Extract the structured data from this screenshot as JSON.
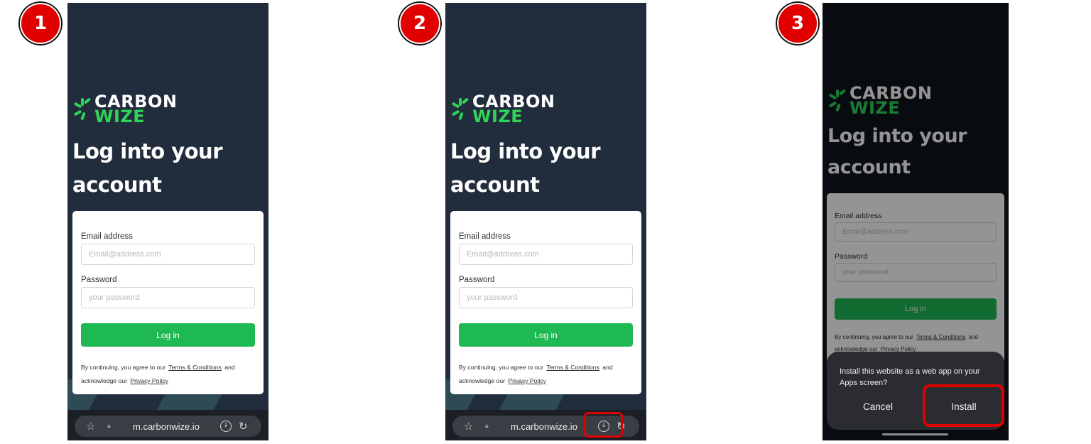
{
  "steps": [
    {
      "badge": "1",
      "logo": {
        "line1": "CARBON",
        "line2": "WIZE"
      },
      "headline": "Log into your account",
      "form": {
        "email_label": "Email address",
        "email_placeholder": "Email@address.com",
        "password_label": "Password",
        "password_placeholder": "your password",
        "login_label": "Log in",
        "legal_prefix": "By continuing, you agree to our",
        "terms_link": "Terms & Conditions",
        "legal_mid": "and acknowledge our",
        "privacy_link": "Privacy Policy"
      },
      "browser": {
        "url": "m.carbonwize.io"
      }
    },
    {
      "badge": "2",
      "logo": {
        "line1": "CARBON",
        "line2": "WIZE"
      },
      "headline": "Log into your account",
      "form": {
        "email_label": "Email address",
        "email_placeholder": "Email@address.com",
        "password_label": "Password",
        "password_placeholder": "your password",
        "login_label": "Log in",
        "legal_prefix": "By continuing, you agree to our",
        "terms_link": "Terms & Conditions",
        "legal_mid": "and acknowledge our",
        "privacy_link": "Privacy Policy"
      },
      "browser": {
        "url": "m.carbonwize.io"
      },
      "highlight": "download-button"
    },
    {
      "badge": "3",
      "logo": {
        "line1": "CARBON",
        "line2": "WIZE"
      },
      "headline": "Log into your account",
      "form": {
        "email_label": "Email address",
        "email_placeholder": "Email@address.com",
        "password_label": "Password",
        "password_placeholder": "your password",
        "login_label": "Log in",
        "legal_prefix": "By continuing, you agree to our",
        "terms_link": "Terms & Conditions",
        "legal_mid": "and acknowledge our",
        "privacy_link": "Privacy Policy"
      },
      "dialog": {
        "message": "Install this website as a web app on your Apps screen?",
        "cancel_label": "Cancel",
        "install_label": "Install"
      },
      "highlight": "install-button"
    }
  ],
  "colors": {
    "badge_red": "#e00000",
    "phone_bg": "#212c3c",
    "brand_green": "#2ed456",
    "button_green": "#1fb954"
  },
  "icons": [
    "star-icon",
    "lock-icon",
    "download-icon",
    "reload-icon"
  ]
}
